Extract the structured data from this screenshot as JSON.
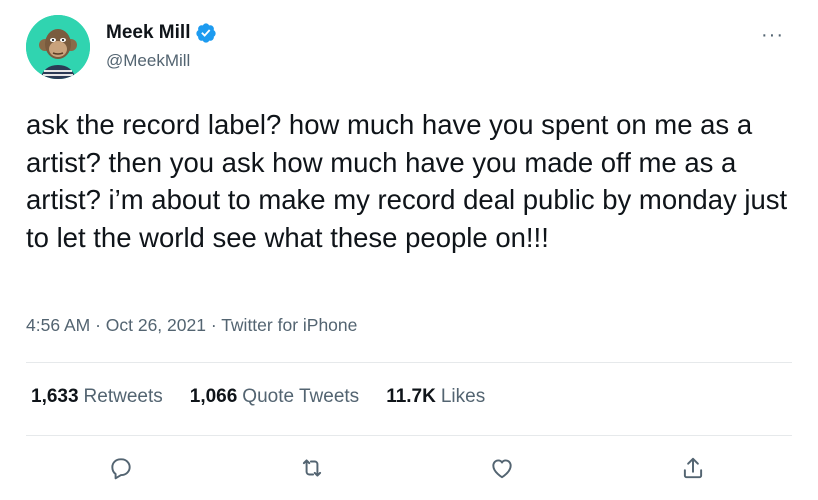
{
  "author": {
    "name": "Meek Mill",
    "handle": "@MeekMill",
    "verified_icon": "verified-badge-icon",
    "avatar_bg": "#30d4b0"
  },
  "tweet": {
    "text": "ask the record label? how much have you spent on me as a artist? then you ask how much have you made off me as a artist? i’m about to make my record deal public by monday just to let the world see what these people on!!!",
    "meta": "4:56 AM · Oct 26, 2021 · Twitter for iPhone"
  },
  "stats": {
    "retweets_count": "1,633",
    "retweets_label": "Retweets",
    "quotes_count": "1,066",
    "quotes_label": "Quote Tweets",
    "likes_count": "11.7K",
    "likes_label": "Likes"
  },
  "more_icon": "···",
  "actions": [
    "reply-icon",
    "retweet-icon",
    "like-icon",
    "share-icon"
  ],
  "colors": {
    "accent": "#1d9bf0",
    "muted": "#536471",
    "text": "#0f1419"
  }
}
